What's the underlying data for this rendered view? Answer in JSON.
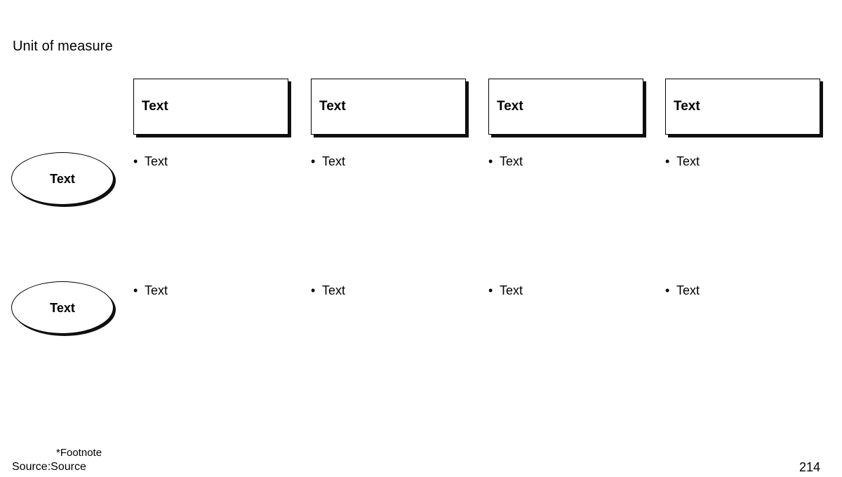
{
  "slide": {
    "title": "Unit of measure",
    "background_color": "#ffffff",
    "text_color": "#000000",
    "shadow_color": "#101010",
    "page_number": "214"
  },
  "header_boxes": [
    {
      "label": "Text"
    },
    {
      "label": "Text"
    },
    {
      "label": "Text"
    },
    {
      "label": "Text"
    }
  ],
  "row_labels": [
    {
      "label": "Text"
    },
    {
      "label": "Text"
    }
  ],
  "bullet_rows": [
    {
      "bullet_glyph": "•",
      "items": [
        {
          "text": "Text"
        },
        {
          "text": "Text"
        },
        {
          "text": "Text"
        },
        {
          "text": "Text"
        }
      ]
    },
    {
      "bullet_glyph": "•",
      "items": [
        {
          "text": "Text"
        },
        {
          "text": "Text"
        },
        {
          "text": "Text"
        },
        {
          "text": "Text"
        }
      ]
    }
  ],
  "footer": {
    "footnote": "*Footnote",
    "source": "Source:Source"
  }
}
